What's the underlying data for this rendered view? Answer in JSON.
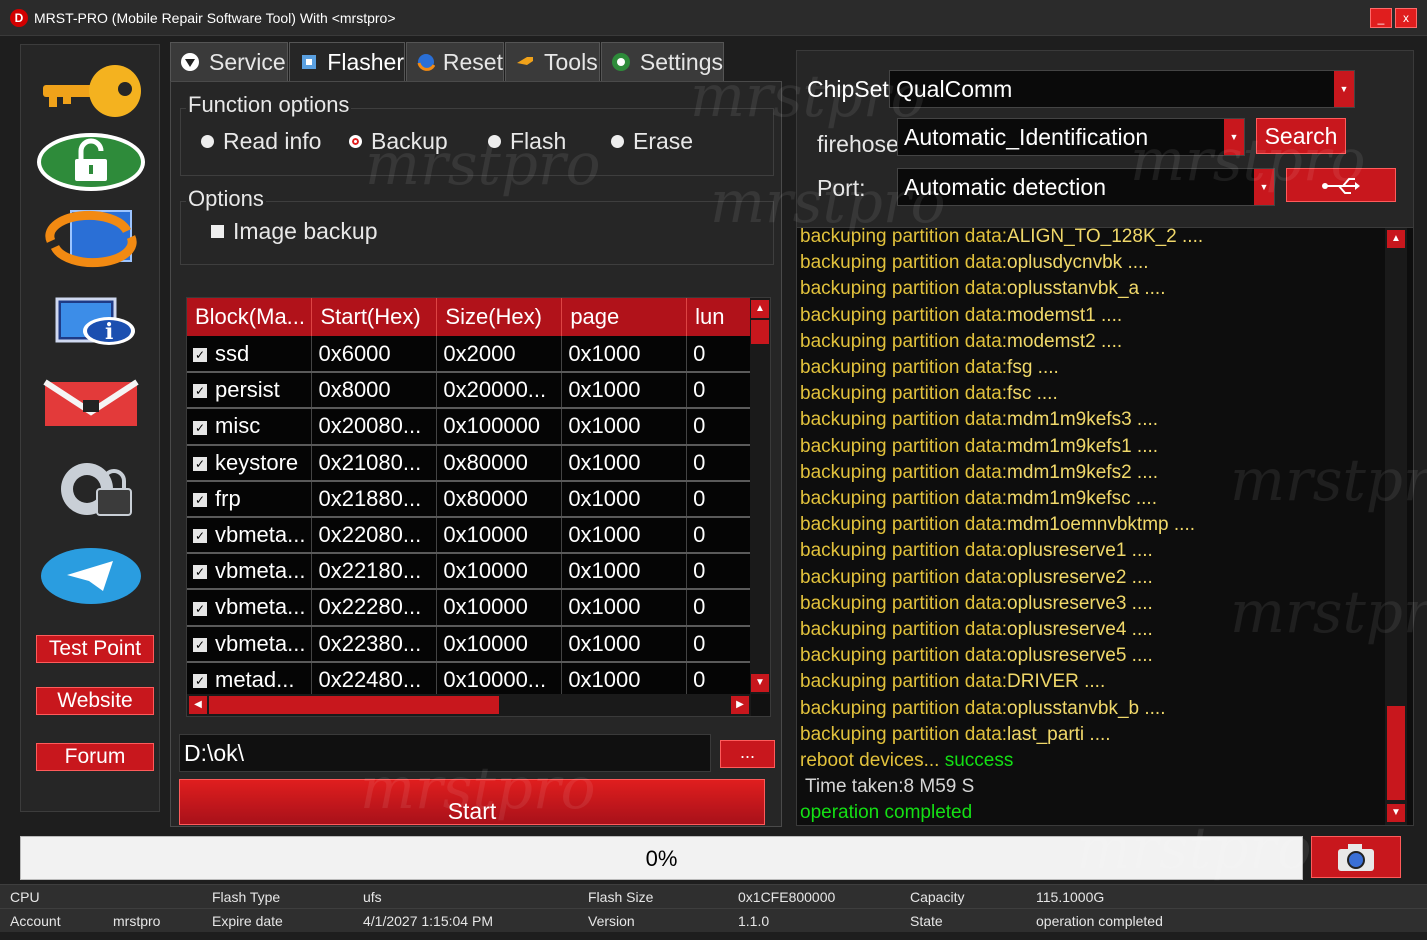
{
  "window": {
    "title": "MRST-PRO (Mobile Repair Software Tool)   With <mrstpro>",
    "icon_letter": "D",
    "minimize": "_",
    "close": "x"
  },
  "sidebar": {
    "icons": [
      "key-icon",
      "unlock-icon",
      "refresh-monitor-icon",
      "info-monitor-icon",
      "mail-lock-icon",
      "gear-lock-icon",
      "telegram-icon"
    ],
    "buttons": {
      "test_point": "Test Point",
      "website": "Website",
      "forum": "Forum"
    }
  },
  "tabs": [
    {
      "label": "Service",
      "icon": "service-icon"
    },
    {
      "label": "Flasher",
      "icon": "flasher-icon"
    },
    {
      "label": "Reset",
      "icon": "reset-icon"
    },
    {
      "label": "Tools",
      "icon": "tools-icon"
    },
    {
      "label": "Settings",
      "icon": "settings-icon"
    }
  ],
  "flasher": {
    "function_options": {
      "title": "Function options",
      "radios": [
        "Read info",
        "Backup",
        "Flash",
        "Erase"
      ],
      "selected": "Backup"
    },
    "options": {
      "title": "Options",
      "image_backup": "Image backup"
    },
    "table": {
      "columns": [
        "Block(Ma...",
        "Start(Hex)",
        "Size(Hex)",
        "page",
        "lun"
      ],
      "rows": [
        [
          "ssd",
          "0x6000",
          "0x2000",
          "0x1000",
          "0"
        ],
        [
          "persist",
          "0x8000",
          "0x20000...",
          "0x1000",
          "0"
        ],
        [
          "misc",
          "0x20080...",
          "0x100000",
          "0x1000",
          "0"
        ],
        [
          "keystore",
          "0x21080...",
          "0x80000",
          "0x1000",
          "0"
        ],
        [
          "frp",
          "0x21880...",
          "0x80000",
          "0x1000",
          "0"
        ],
        [
          "vbmeta...",
          "0x22080...",
          "0x10000",
          "0x1000",
          "0"
        ],
        [
          "vbmeta...",
          "0x22180...",
          "0x10000",
          "0x1000",
          "0"
        ],
        [
          "vbmeta...",
          "0x22280...",
          "0x10000",
          "0x1000",
          "0"
        ],
        [
          "vbmeta...",
          "0x22380...",
          "0x10000",
          "0x1000",
          "0"
        ],
        [
          "metad...",
          "0x22480...",
          "0x10000...",
          "0x1000",
          "0"
        ]
      ]
    },
    "path": "D:\\ok\\",
    "browse_label": "...",
    "start_label": "Start"
  },
  "right": {
    "chipset_label": "ChipSet",
    "chipset_value": "QualComm",
    "firehose_label": "firehose",
    "firehose_value": "Automatic_Identification",
    "search_label": "Search",
    "port_label": "Port:",
    "port_value": "Automatic detection"
  },
  "log": [
    {
      "prefix": "backuping partition data:",
      "name": "ALIGN_TO_128K_2 ....",
      "suffix": ""
    },
    {
      "prefix": "backuping partition data:",
      "name": "oplusdycnvbk ....",
      "suffix": ""
    },
    {
      "prefix": "backuping partition data:",
      "name": "oplusstanvbk_a ....",
      "suffix": ""
    },
    {
      "prefix": "backuping partition data:",
      "name": "modemst1 ....",
      "suffix": ""
    },
    {
      "prefix": "backuping partition data:",
      "name": "modemst2 ....",
      "suffix": ""
    },
    {
      "prefix": "backuping partition data:",
      "name": "fsg ....",
      "suffix": ""
    },
    {
      "prefix": "backuping partition data:",
      "name": "fsc ....",
      "suffix": ""
    },
    {
      "prefix": "backuping partition data:",
      "name": "mdm1m9kefs3 ....",
      "suffix": ""
    },
    {
      "prefix": "backuping partition data:",
      "name": "mdm1m9kefs1 ....",
      "suffix": ""
    },
    {
      "prefix": "backuping partition data:",
      "name": "mdm1m9kefs2 ....",
      "suffix": ""
    },
    {
      "prefix": "backuping partition data:",
      "name": "mdm1m9kefsc ....",
      "suffix": ""
    },
    {
      "prefix": "backuping partition data:",
      "name": "mdm1oemnvbktmp ....",
      "suffix": ""
    },
    {
      "prefix": "backuping partition data:",
      "name": "oplusreserve1 ....",
      "suffix": ""
    },
    {
      "prefix": "backuping partition data:",
      "name": "oplusreserve2 ....",
      "suffix": ""
    },
    {
      "prefix": "backuping partition data:",
      "name": "oplusreserve3 ....",
      "suffix": ""
    },
    {
      "prefix": "backuping partition data:",
      "name": "oplusreserve4 ....",
      "suffix": ""
    },
    {
      "prefix": "backuping partition data:",
      "name": "oplusreserve5 ....",
      "suffix": ""
    },
    {
      "prefix": "backuping partition data:",
      "name": "DRIVER ....",
      "suffix": ""
    },
    {
      "prefix": "backuping partition data:",
      "name": "oplusstanvbk_b ....",
      "suffix": ""
    },
    {
      "prefix": "backuping partition data:",
      "name": "last_parti ....",
      "suffix": ""
    },
    {
      "prefix": "reboot devices... ",
      "name": "",
      "suffix": "success"
    },
    {
      "prefix": "",
      "name": "Time taken:8 M59 S",
      "suffix": ""
    },
    {
      "prefix": "",
      "name": "",
      "suffix": "operation completed"
    }
  ],
  "progress": {
    "label": "0%",
    "value": 0
  },
  "status": {
    "cpu_label": "CPU",
    "flash_type_label": "Flash Type",
    "flash_type_value": "ufs",
    "flash_size_label": "Flash Size",
    "flash_size_value": "0x1CFE800000",
    "capacity_label": "Capacity",
    "capacity_value": "115.1000G",
    "account_label": "Account",
    "account_value": "mrstpro",
    "expire_label": "Expire date",
    "expire_value": "4/1/2027 1:15:04 PM",
    "version_label": "Version",
    "version_value": "1.1.0",
    "state_label": "State",
    "state_value": "operation completed"
  },
  "watermark": "mrstpro",
  "colors": {
    "accent_red": "#c8171d",
    "log_yellow": "#e2c23c",
    "log_green": "#14e014"
  }
}
